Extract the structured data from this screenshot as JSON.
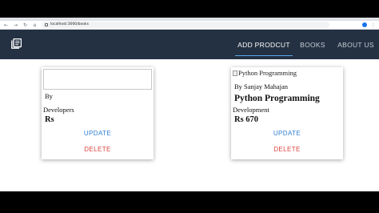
{
  "browser": {
    "url": "localhost:3000/books",
    "nav_icons": [
      "back-icon",
      "forward-icon",
      "reload-icon",
      "home-icon"
    ]
  },
  "header": {
    "logo_icon": "book-icon",
    "nav": {
      "add_product": "ADD PRODCUT",
      "books": "BOOKS",
      "about_us": "ABOUT US"
    },
    "active_nav": "add_product",
    "colors": {
      "bar": "#233142",
      "accent": "#5aa8e6"
    }
  },
  "books": [
    {
      "image_alt": "",
      "author_line": "By",
      "category": "Developers",
      "title": "",
      "price": "Rs",
      "update_label": "UPDATE",
      "delete_label": "DELETE"
    },
    {
      "image_alt": "Python Programming",
      "author_line": "By Sanjay Mahajan",
      "category": "Development",
      "title": "Python Programming",
      "price": "Rs 670",
      "update_label": "UPDATE",
      "delete_label": "DELETE"
    }
  ],
  "colors": {
    "update": "#2f7fd1",
    "delete": "#d9443f"
  }
}
